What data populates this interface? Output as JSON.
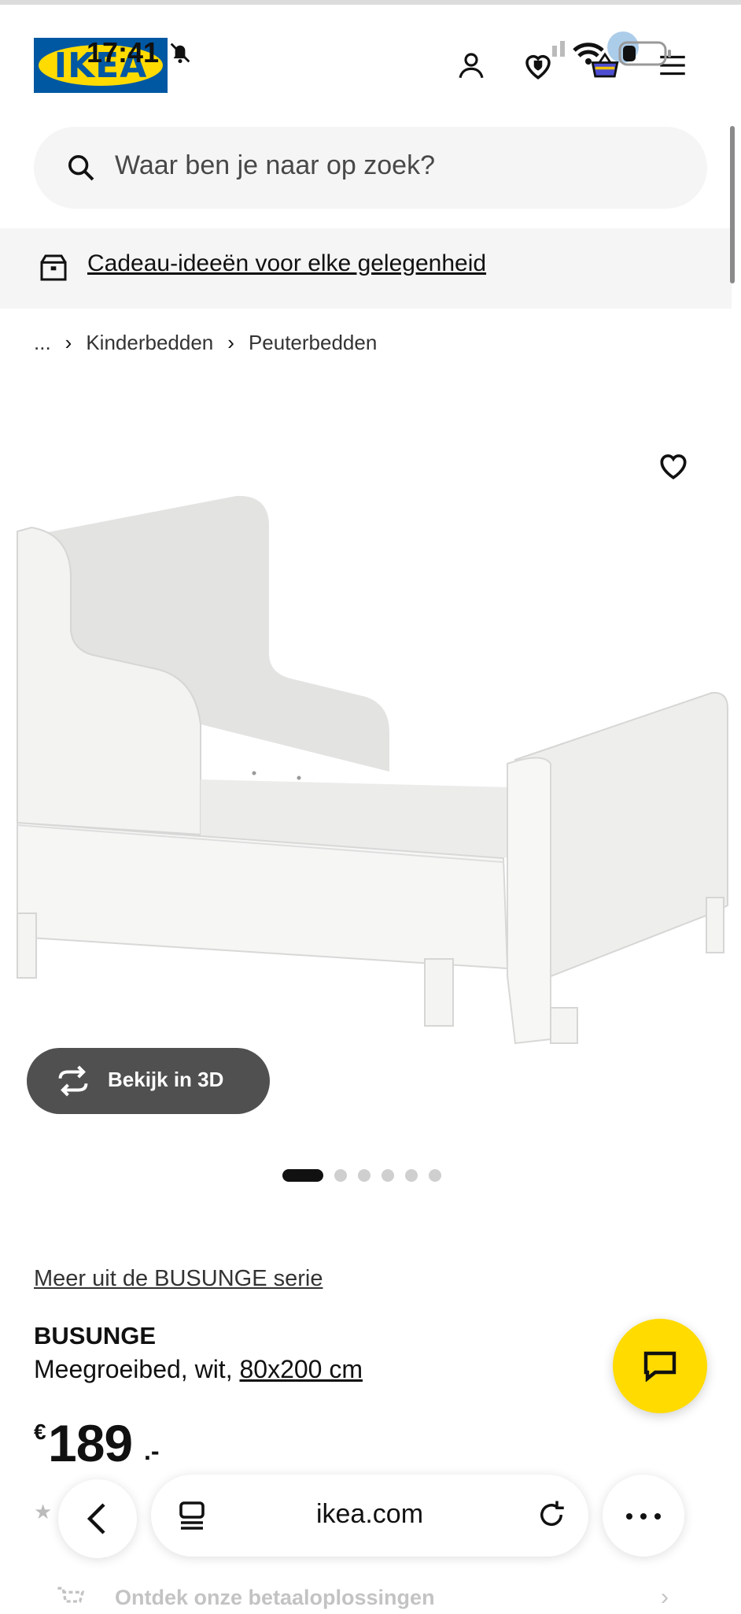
{
  "status_bar": {
    "time": "17:41"
  },
  "header": {
    "logo_text": "IKEA",
    "icons": [
      "account-icon",
      "heart-shield-icon",
      "basket-icon",
      "menu-icon"
    ]
  },
  "search": {
    "placeholder": "Waar ben je naar op zoek?"
  },
  "promo": {
    "label": "Cadeau-ideeën voor elke gelegenheid"
  },
  "breadcrumb": {
    "ellipsis": "...",
    "items": [
      "Kinderbedden",
      "Peuterbedden"
    ]
  },
  "gallery": {
    "view_3d_label": "Bekijk in 3D",
    "image_count": 6,
    "active_index": 0
  },
  "product": {
    "series_link": "Meer uit de BUSUNGE serie",
    "name": "BUSUNGE",
    "description": "Meegroeibed, wit,",
    "size": "80x200 cm",
    "currency": "€",
    "price": "189",
    "price_tail": ".-"
  },
  "payment": {
    "label": "Ontdek onze betaaloplossingen"
  },
  "browser": {
    "url": "ikea.com"
  },
  "colors": {
    "ikea_blue": "#0058a3",
    "ikea_yellow": "#ffdb00",
    "button_dark": "#505050"
  }
}
